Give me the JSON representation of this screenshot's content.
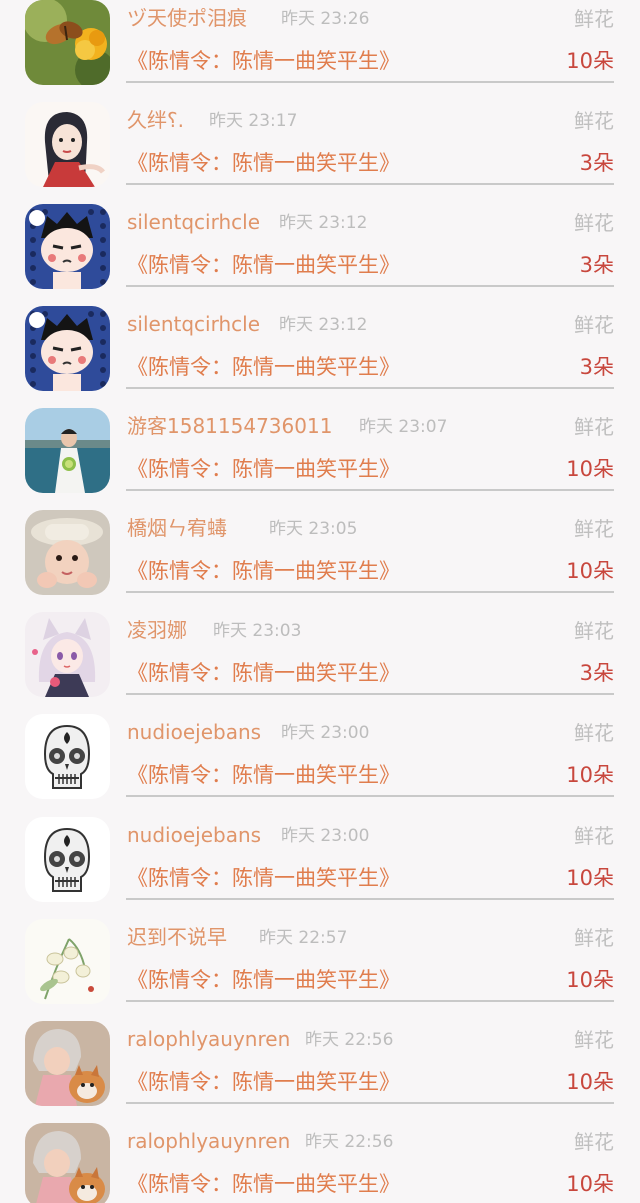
{
  "gift_records": [
    {
      "user_name": "ヅ天使ポ泪痕",
      "time": "昨天 23:26",
      "gift_type": "鲜花",
      "work_title": "《陈情令：陈情一曲笑平生》",
      "count": "10朵",
      "avatar": "butterfly-flower-avatar"
    },
    {
      "user_name": "久绊⸮.",
      "time": "昨天 23:17",
      "gift_type": "鲜花",
      "work_title": "《陈情令：陈情一曲笑平生》",
      "count": "3朵",
      "avatar": "ancient-girl-avatar"
    },
    {
      "user_name": "silentqcirhcle",
      "time": "昨天 23:12",
      "gift_type": "鲜花",
      "work_title": "《陈情令：陈情一曲笑平生》",
      "count": "3朵",
      "avatar": "cartoon-boy-avatar"
    },
    {
      "user_name": "silentqcirhcle",
      "time": "昨天 23:12",
      "gift_type": "鲜花",
      "work_title": "《陈情令：陈情一曲笑平生》",
      "count": "3朵",
      "avatar": "cartoon-boy-avatar"
    },
    {
      "user_name": "游客1581154736011",
      "time": "昨天 23:07",
      "gift_type": "鲜花",
      "work_title": "《陈情令：陈情一曲笑平生》",
      "count": "10朵",
      "avatar": "bride-seaside-avatar"
    },
    {
      "user_name": "橋烟ㄣ宥蝳",
      "time": "昨天 23:05",
      "gift_type": "鲜花",
      "work_title": "《陈情令：陈情一曲笑平生》",
      "count": "10朵",
      "avatar": "child-hat-avatar"
    },
    {
      "user_name": "凌羽娜",
      "time": "昨天 23:03",
      "gift_type": "鲜花",
      "work_title": "《陈情令：陈情一曲笑平生》",
      "count": "3朵",
      "avatar": "anime-catgirl-avatar"
    },
    {
      "user_name": "nudioejebans",
      "time": "昨天 23:00",
      "gift_type": "鲜花",
      "work_title": "《陈情令：陈情一曲笑平生》",
      "count": "10朵",
      "avatar": "sugar-skull-avatar"
    },
    {
      "user_name": "nudioejebans",
      "time": "昨天 23:00",
      "gift_type": "鲜花",
      "work_title": "《陈情令：陈情一曲笑平生》",
      "count": "10朵",
      "avatar": "sugar-skull-avatar"
    },
    {
      "user_name": "迟到不说早",
      "time": "昨天 22:57",
      "gift_type": "鲜花",
      "work_title": "《陈情令：陈情一曲笑平生》",
      "count": "10朵",
      "avatar": "lily-flower-avatar"
    },
    {
      "user_name": "ralophlyauynren",
      "time": "昨天 22:56",
      "gift_type": "鲜花",
      "work_title": "《陈情令：陈情一曲笑平生》",
      "count": "10朵",
      "avatar": "girl-dog-avatar"
    },
    {
      "user_name": "ralophlyauynren",
      "time": "昨天 22:56",
      "gift_type": "鲜花",
      "work_title": "《陈情令：陈情一曲笑平生》",
      "count": "10朵",
      "avatar": "girl-dog-avatar"
    }
  ]
}
